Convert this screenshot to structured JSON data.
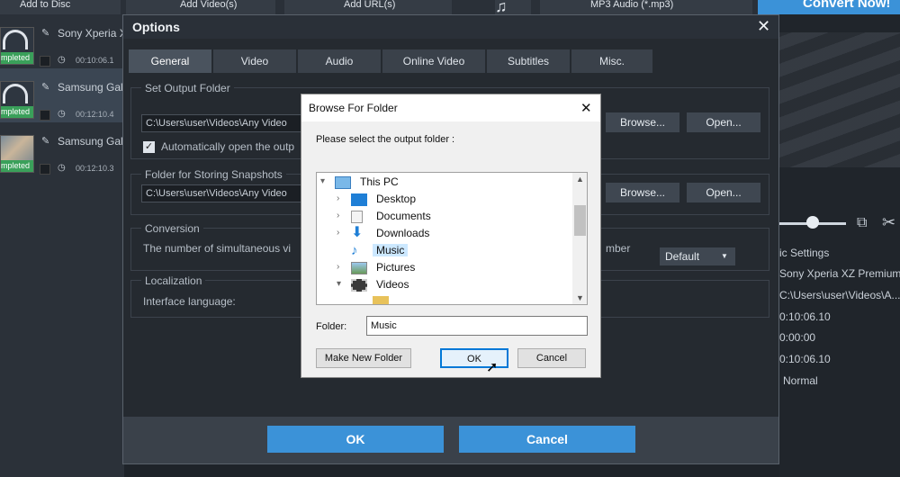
{
  "topbar": {
    "add_disc": "Add to Disc",
    "add_video": "Add Video(s)",
    "add_url": "Add URL(s)",
    "output_format": "MP3 Audio (*.mp3)",
    "convert_now": "Convert Now!"
  },
  "videos": [
    {
      "name": "Sony Xperia X",
      "duration": "00:10:06.1",
      "status": "mpleted"
    },
    {
      "name": "Samsung Gal",
      "duration": "00:12:10.4",
      "status": "mpleted"
    },
    {
      "name": "Samsung Gal",
      "duration": "00:12:10.3",
      "status": "mpleted"
    }
  ],
  "right_panel": {
    "section_title": "ic Settings",
    "rows": [
      "Sony Xperia XZ Premium",
      "C:\\Users\\user\\Videos\\A...",
      "0:10:06.10",
      "0:00:00",
      "0:10:06.10",
      "Normal"
    ]
  },
  "options": {
    "title": "Options",
    "tabs": [
      "General",
      "Video",
      "Audio",
      "Online Video",
      "Subtitles",
      "Misc."
    ],
    "output_group": "Set Output Folder",
    "output_path": "C:\\Users\\user\\Videos\\Any Video",
    "auto_open": "Automatically open the outp",
    "browse": "Browse...",
    "open": "Open...",
    "snapshot_group": "Folder for Storing Snapshots",
    "snapshot_path": "C:\\Users\\user\\Videos\\Any Video",
    "conversion_group": "Conversion",
    "conversion_text_left": "The number of simultaneous vi",
    "conversion_text_right": "mber",
    "conversion_value": "Default",
    "localization_group": "Localization",
    "language_label": "Interface language:",
    "ok": "OK",
    "cancel": "Cancel"
  },
  "browse_dialog": {
    "title": "Browse For Folder",
    "prompt": "Please select the output folder :",
    "tree": [
      "This PC",
      "Desktop",
      "Documents",
      "Downloads",
      "Music",
      "Pictures",
      "Videos"
    ],
    "selected": "Music",
    "folder_label": "Folder:",
    "folder_value": "Music",
    "make_new_folder": "Make New Folder",
    "ok": "OK",
    "cancel": "Cancel"
  }
}
